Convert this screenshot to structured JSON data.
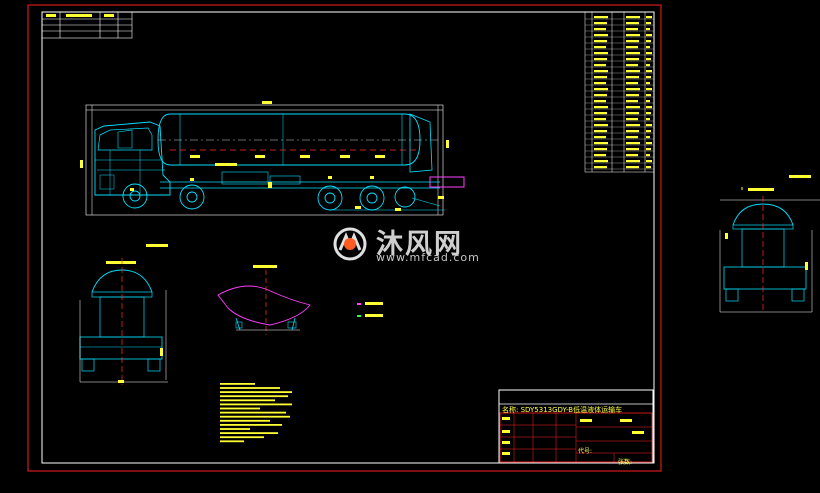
{
  "title_block": {
    "drawing_name": "名称: SDY5313GDY-B低温液体运输车",
    "code_label": "代号: ",
    "sheet_label": "张数: "
  },
  "watermark": {
    "brand": "沐风网",
    "url": "www.mfcad.com"
  },
  "colors": {
    "background": "#000000",
    "sheet_border": "#ff2020",
    "frame": "#ffffff",
    "cyan_lines": "#00e0ff",
    "yellow_text": "#ffff33",
    "red_centerline": "#ff3030",
    "magenta": "#ff40ff",
    "green": "#30ff30"
  }
}
